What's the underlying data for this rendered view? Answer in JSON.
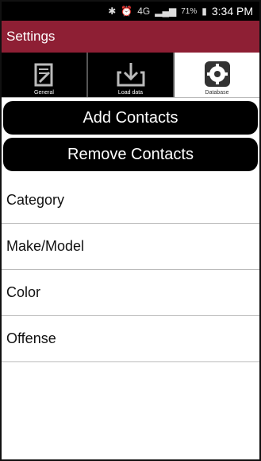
{
  "status": {
    "time": "3:34 PM",
    "battery": "71%",
    "network": "4G"
  },
  "app": {
    "title": "Settings"
  },
  "tabs": [
    {
      "label": "General",
      "icon": "document-edit-icon",
      "active": false
    },
    {
      "label": "Load data",
      "icon": "download-tray-icon",
      "active": false
    },
    {
      "label": "Database",
      "icon": "gear-icon",
      "active": true
    }
  ],
  "buttons": {
    "add_contacts": "Add Contacts",
    "remove_contacts": "Remove Contacts"
  },
  "list": [
    {
      "label": "Category"
    },
    {
      "label": "Make/Model"
    },
    {
      "label": "Color"
    },
    {
      "label": "Offense"
    }
  ]
}
